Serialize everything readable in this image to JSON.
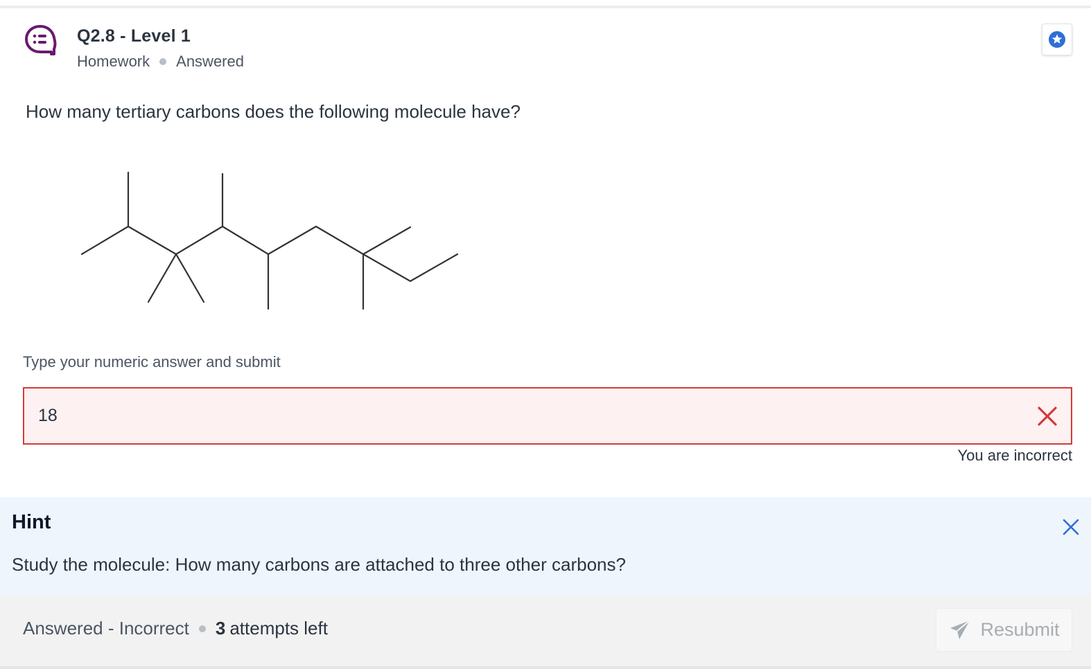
{
  "question": {
    "title": "Q2.8 - Level 1",
    "category": "Homework",
    "state": "Answered",
    "prompt": "How many tertiary carbons does the following molecule have?"
  },
  "answer": {
    "instruction": "Type your numeric answer and submit",
    "value": "18",
    "feedback": "You are incorrect"
  },
  "hint": {
    "title": "Hint",
    "text": "Study the molecule: How many carbons are attached to three other carbons?"
  },
  "footer": {
    "status": "Answered - Incorrect",
    "attempts_count": "3",
    "attempts_label": "attempts left",
    "resubmit_label": "Resubmit"
  },
  "colors": {
    "accent_purple": "#6a1a6e",
    "error_red": "#d33a3a",
    "hint_blue": "#2f6fd6"
  },
  "icons": {
    "question_type": "speech-bubble-list-icon",
    "bookmark": "star-badge-icon",
    "clear": "close-x-icon",
    "hint_close": "close-icon",
    "resubmit": "send-icon"
  }
}
